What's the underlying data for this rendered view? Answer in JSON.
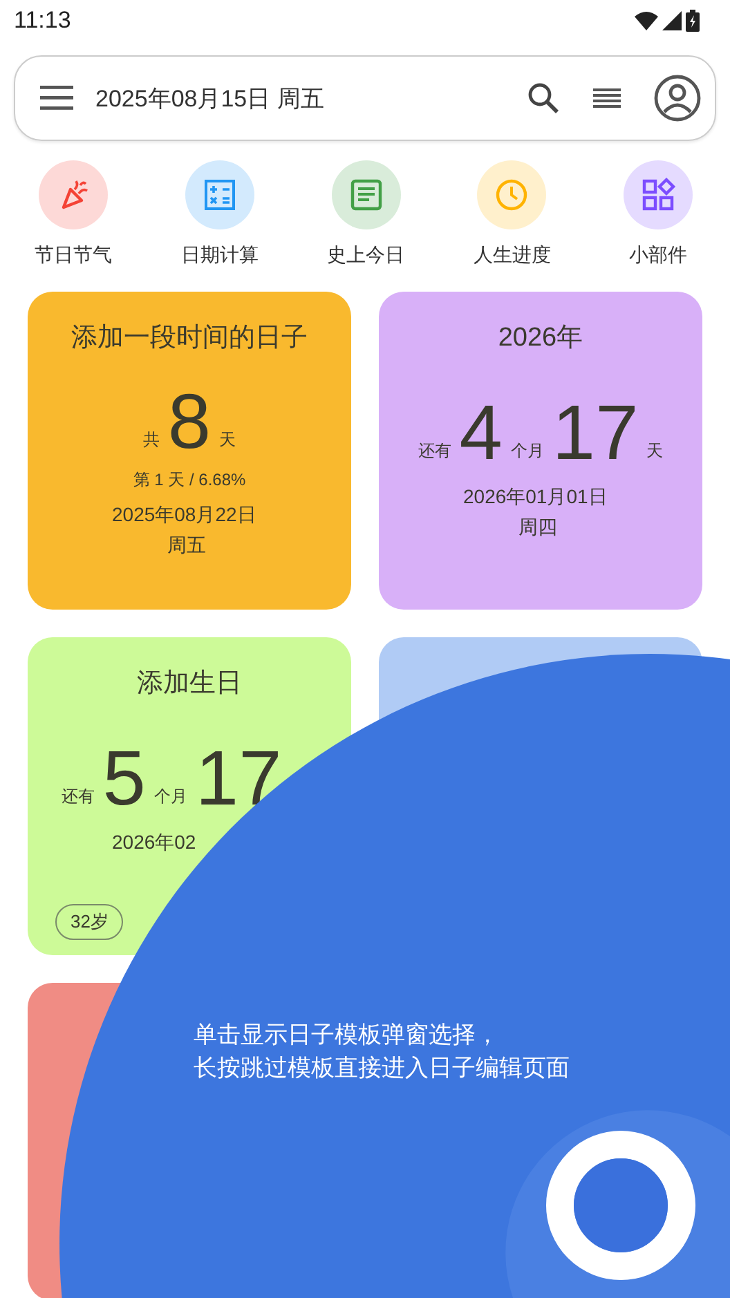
{
  "status_bar": {
    "time": "11:13"
  },
  "search_bar": {
    "date": "2025年08月15日 周五"
  },
  "shortcuts": [
    {
      "label": "节日节气",
      "kind": "party",
      "color": "#f44336"
    },
    {
      "label": "日期计算",
      "kind": "calculator",
      "color": "#2196f3"
    },
    {
      "label": "史上今日",
      "kind": "article",
      "color": "#43a047"
    },
    {
      "label": "人生进度",
      "kind": "clock",
      "color": "#ffb300"
    },
    {
      "label": "小部件",
      "kind": "widgets",
      "color": "#7c4dff"
    }
  ],
  "cards": [
    {
      "title": "添加一段时间的日子",
      "color": "#f9b92e",
      "count": [
        {
          "kind": "unit",
          "text": "共"
        },
        {
          "kind": "number",
          "text": "8"
        },
        {
          "kind": "unit",
          "text": "天"
        }
      ],
      "progress": "第 1 天 / 6.68%",
      "date": "2025年08月22日",
      "weekday": "周五"
    },
    {
      "title": "2026年",
      "color": "#d8b0f8",
      "count": [
        {
          "kind": "unit",
          "text": "还有"
        },
        {
          "kind": "number",
          "text": "4"
        },
        {
          "kind": "unit",
          "text": "个月"
        },
        {
          "kind": "number",
          "text": "17"
        },
        {
          "kind": "unit",
          "text": "天"
        }
      ],
      "date": "2026年01月01日",
      "weekday": "周四"
    },
    {
      "title": "添加生日",
      "color": "#cdfa98",
      "count": [
        {
          "kind": "unit",
          "text": "还有"
        },
        {
          "kind": "number",
          "text": "5"
        },
        {
          "kind": "unit",
          "text": "个月"
        },
        {
          "kind": "number",
          "text": "17"
        }
      ],
      "date": "2026年02",
      "chips": [
        "32岁"
      ]
    },
    {
      "color": "#b0cbf5"
    },
    {
      "color": "#f08c84"
    }
  ],
  "hint": {
    "lines": [
      "单击显示日子模板弹窗选择，",
      "长按跳过模板直接进入日子编辑页面"
    ]
  }
}
